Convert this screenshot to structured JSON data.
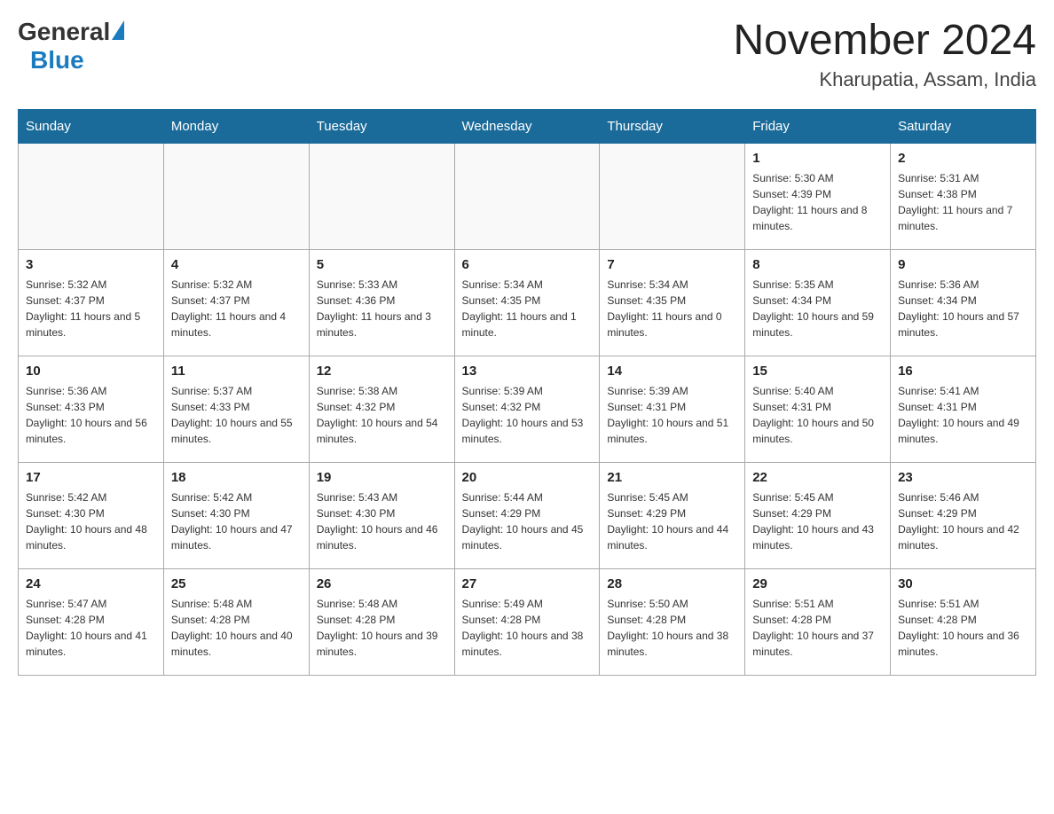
{
  "header": {
    "logo_general": "General",
    "logo_blue": "Blue",
    "month_title": "November 2024",
    "location": "Kharupatia, Assam, India"
  },
  "weekdays": [
    "Sunday",
    "Monday",
    "Tuesday",
    "Wednesday",
    "Thursday",
    "Friday",
    "Saturday"
  ],
  "weeks": [
    [
      {
        "day": "",
        "info": ""
      },
      {
        "day": "",
        "info": ""
      },
      {
        "day": "",
        "info": ""
      },
      {
        "day": "",
        "info": ""
      },
      {
        "day": "",
        "info": ""
      },
      {
        "day": "1",
        "info": "Sunrise: 5:30 AM\nSunset: 4:39 PM\nDaylight: 11 hours and 8 minutes."
      },
      {
        "day": "2",
        "info": "Sunrise: 5:31 AM\nSunset: 4:38 PM\nDaylight: 11 hours and 7 minutes."
      }
    ],
    [
      {
        "day": "3",
        "info": "Sunrise: 5:32 AM\nSunset: 4:37 PM\nDaylight: 11 hours and 5 minutes."
      },
      {
        "day": "4",
        "info": "Sunrise: 5:32 AM\nSunset: 4:37 PM\nDaylight: 11 hours and 4 minutes."
      },
      {
        "day": "5",
        "info": "Sunrise: 5:33 AM\nSunset: 4:36 PM\nDaylight: 11 hours and 3 minutes."
      },
      {
        "day": "6",
        "info": "Sunrise: 5:34 AM\nSunset: 4:35 PM\nDaylight: 11 hours and 1 minute."
      },
      {
        "day": "7",
        "info": "Sunrise: 5:34 AM\nSunset: 4:35 PM\nDaylight: 11 hours and 0 minutes."
      },
      {
        "day": "8",
        "info": "Sunrise: 5:35 AM\nSunset: 4:34 PM\nDaylight: 10 hours and 59 minutes."
      },
      {
        "day": "9",
        "info": "Sunrise: 5:36 AM\nSunset: 4:34 PM\nDaylight: 10 hours and 57 minutes."
      }
    ],
    [
      {
        "day": "10",
        "info": "Sunrise: 5:36 AM\nSunset: 4:33 PM\nDaylight: 10 hours and 56 minutes."
      },
      {
        "day": "11",
        "info": "Sunrise: 5:37 AM\nSunset: 4:33 PM\nDaylight: 10 hours and 55 minutes."
      },
      {
        "day": "12",
        "info": "Sunrise: 5:38 AM\nSunset: 4:32 PM\nDaylight: 10 hours and 54 minutes."
      },
      {
        "day": "13",
        "info": "Sunrise: 5:39 AM\nSunset: 4:32 PM\nDaylight: 10 hours and 53 minutes."
      },
      {
        "day": "14",
        "info": "Sunrise: 5:39 AM\nSunset: 4:31 PM\nDaylight: 10 hours and 51 minutes."
      },
      {
        "day": "15",
        "info": "Sunrise: 5:40 AM\nSunset: 4:31 PM\nDaylight: 10 hours and 50 minutes."
      },
      {
        "day": "16",
        "info": "Sunrise: 5:41 AM\nSunset: 4:31 PM\nDaylight: 10 hours and 49 minutes."
      }
    ],
    [
      {
        "day": "17",
        "info": "Sunrise: 5:42 AM\nSunset: 4:30 PM\nDaylight: 10 hours and 48 minutes."
      },
      {
        "day": "18",
        "info": "Sunrise: 5:42 AM\nSunset: 4:30 PM\nDaylight: 10 hours and 47 minutes."
      },
      {
        "day": "19",
        "info": "Sunrise: 5:43 AM\nSunset: 4:30 PM\nDaylight: 10 hours and 46 minutes."
      },
      {
        "day": "20",
        "info": "Sunrise: 5:44 AM\nSunset: 4:29 PM\nDaylight: 10 hours and 45 minutes."
      },
      {
        "day": "21",
        "info": "Sunrise: 5:45 AM\nSunset: 4:29 PM\nDaylight: 10 hours and 44 minutes."
      },
      {
        "day": "22",
        "info": "Sunrise: 5:45 AM\nSunset: 4:29 PM\nDaylight: 10 hours and 43 minutes."
      },
      {
        "day": "23",
        "info": "Sunrise: 5:46 AM\nSunset: 4:29 PM\nDaylight: 10 hours and 42 minutes."
      }
    ],
    [
      {
        "day": "24",
        "info": "Sunrise: 5:47 AM\nSunset: 4:28 PM\nDaylight: 10 hours and 41 minutes."
      },
      {
        "day": "25",
        "info": "Sunrise: 5:48 AM\nSunset: 4:28 PM\nDaylight: 10 hours and 40 minutes."
      },
      {
        "day": "26",
        "info": "Sunrise: 5:48 AM\nSunset: 4:28 PM\nDaylight: 10 hours and 39 minutes."
      },
      {
        "day": "27",
        "info": "Sunrise: 5:49 AM\nSunset: 4:28 PM\nDaylight: 10 hours and 38 minutes."
      },
      {
        "day": "28",
        "info": "Sunrise: 5:50 AM\nSunset: 4:28 PM\nDaylight: 10 hours and 38 minutes."
      },
      {
        "day": "29",
        "info": "Sunrise: 5:51 AM\nSunset: 4:28 PM\nDaylight: 10 hours and 37 minutes."
      },
      {
        "day": "30",
        "info": "Sunrise: 5:51 AM\nSunset: 4:28 PM\nDaylight: 10 hours and 36 minutes."
      }
    ]
  ]
}
